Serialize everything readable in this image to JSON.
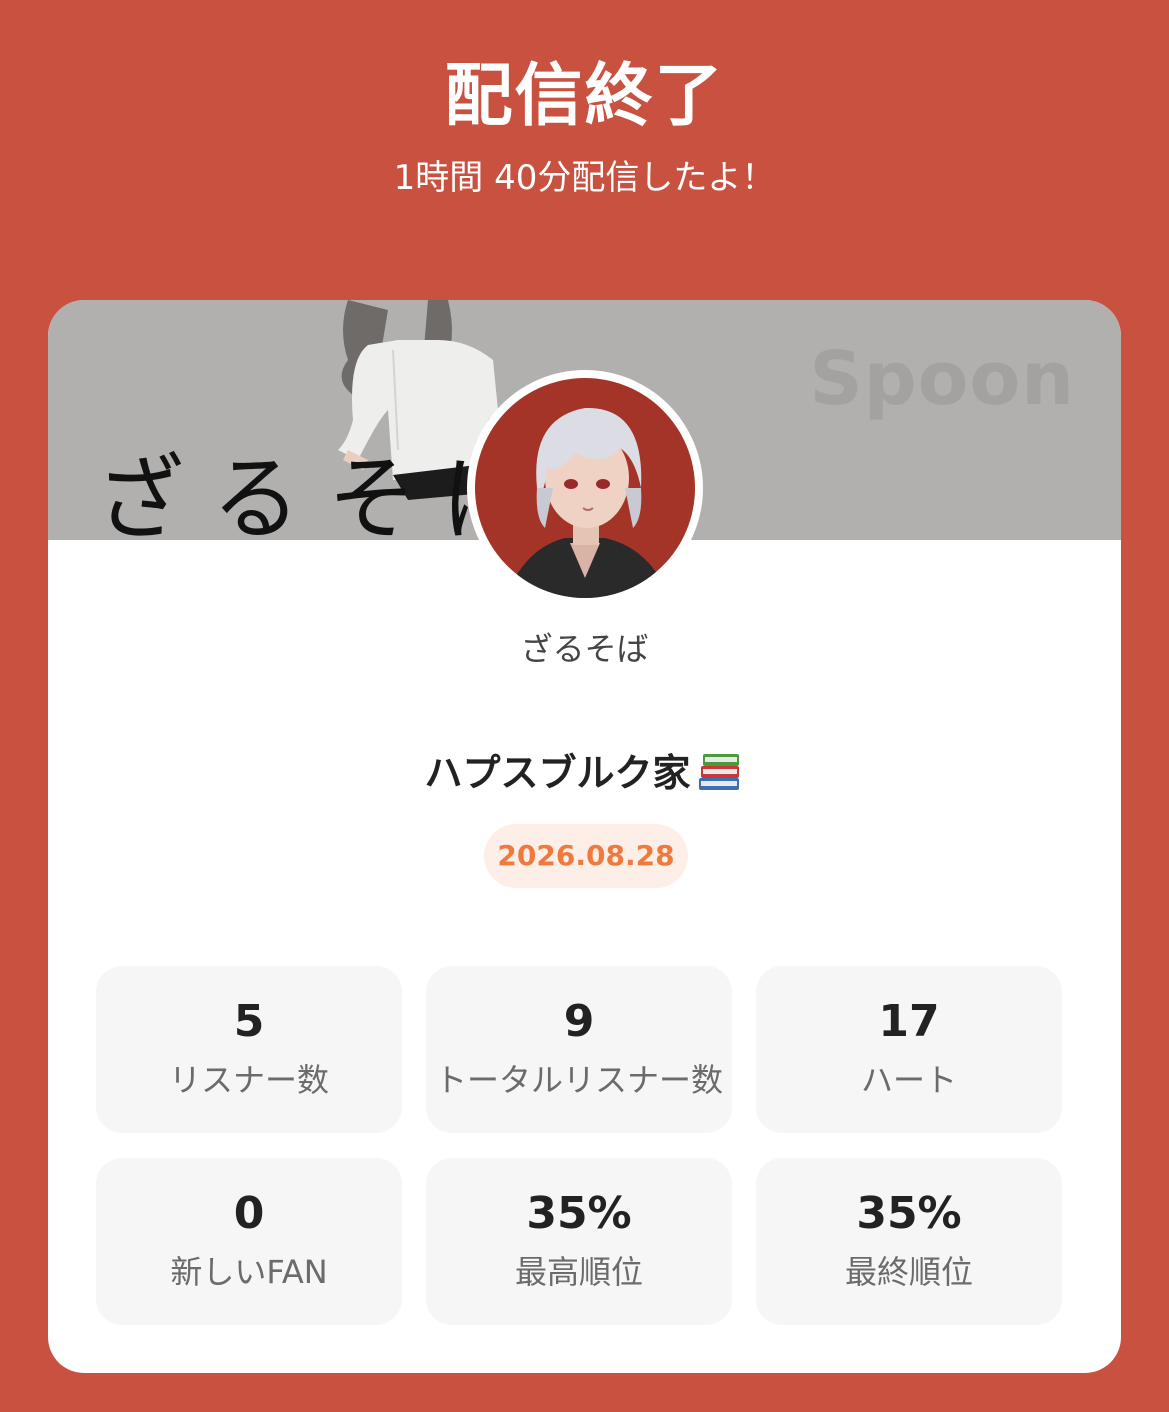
{
  "header": {
    "title": "配信終了",
    "subtitle": "1時間 40分配信したよ！"
  },
  "card": {
    "banner": {
      "text": "ざるそば",
      "logo": "Spoon"
    },
    "nickname": "ざるそば",
    "live_title": "ハプスブルク家",
    "title_emoji_icon": "books-icon",
    "date": "2026.08.28",
    "stats": [
      {
        "value": "5",
        "label": "リスナー数"
      },
      {
        "value": "9",
        "label": "トータルリスナー数"
      },
      {
        "value": "17",
        "label": "ハート"
      },
      {
        "value": "0",
        "label": "新しいFAN"
      },
      {
        "value": "35%",
        "label": "最高順位"
      },
      {
        "value": "35%",
        "label": "最終順位"
      }
    ]
  },
  "colors": {
    "background": "#c85140",
    "card": "#ffffff",
    "banner": "#b1b0ae",
    "date_pill_bg": "#fdeee8",
    "date_pill_text": "#f07a3d",
    "stat_bg": "#f6f6f6"
  }
}
